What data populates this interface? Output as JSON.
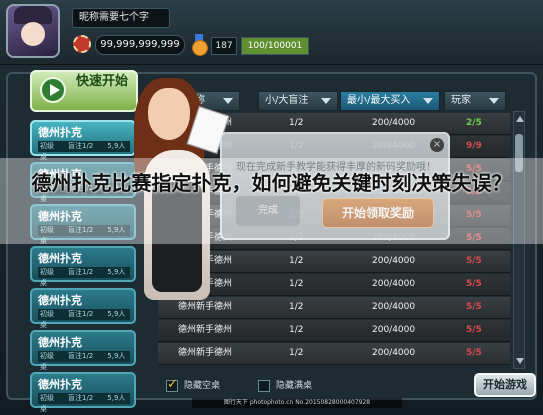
{
  "player": {
    "nickname": "昵称需要七个字",
    "coins": "99,999,999,999",
    "level": "187",
    "xp_text": "100/100001",
    "xp_fraction": 1.0
  },
  "quick_start": {
    "label": "快速开始"
  },
  "room_list": [
    {
      "name": "德州扑克",
      "sub": "初级　　盲注1/2　　5,9人桌"
    },
    {
      "name": "德州扑克",
      "sub": "初级　　盲注1/2　　5,9人桌"
    },
    {
      "name": "德州扑克",
      "sub": "初级　　盲注1/2　　5,9人桌"
    },
    {
      "name": "德州扑克",
      "sub": "初级　　盲注1/2　　5,9人桌"
    },
    {
      "name": "德州扑克",
      "sub": "初级　　盲注1/2　　5,9人桌"
    },
    {
      "name": "德州扑克",
      "sub": "初级　　盲注1/2　　5,9人桌"
    },
    {
      "name": "德州扑克",
      "sub": "初级　　盲注1/2　　5,9人桌"
    }
  ],
  "table": {
    "columns": [
      "名称",
      "小/大盲注",
      "最小/最大买入",
      "玩家"
    ],
    "rows": [
      {
        "name": "德州新手德州",
        "blinds": "1/2",
        "buyin": "200/4000",
        "players": "2/5",
        "status": "green"
      },
      {
        "name": "德州新手德州",
        "blinds": "1/2",
        "buyin": "200/4000",
        "players": "9/9",
        "status": "red"
      },
      {
        "name": "德州新手德州",
        "blinds": "1/2",
        "buyin": "200/4000",
        "players": "5/5",
        "status": "red"
      },
      {
        "name": "德州新手德州",
        "blinds": "1/2",
        "buyin": "200/4000",
        "players": "5/5",
        "status": "red"
      },
      {
        "name": "德州新手德州",
        "blinds": "1/2",
        "buyin": "200/4000",
        "players": "5/5",
        "status": "red"
      },
      {
        "name": "德州新手德州",
        "blinds": "1/2",
        "buyin": "200/4000",
        "players": "5/5",
        "status": "red"
      },
      {
        "name": "德州新手德州",
        "blinds": "1/2",
        "buyin": "200/4000",
        "players": "5/5",
        "status": "red"
      },
      {
        "name": "德州新手德州",
        "blinds": "1/2",
        "buyin": "200/4000",
        "players": "5/5",
        "status": "red"
      },
      {
        "name": "德州新手德州",
        "blinds": "1/2",
        "buyin": "200/4000",
        "players": "5/5",
        "status": "red"
      },
      {
        "name": "德州新手德州",
        "blinds": "1/2",
        "buyin": "200/4000",
        "players": "5/5",
        "status": "red"
      },
      {
        "name": "德州新手德州",
        "blinds": "1/2",
        "buyin": "200/4000",
        "players": "5/5",
        "status": "red"
      }
    ]
  },
  "promo": {
    "text": "现在完成新手教学能获得丰厚的新码奖励哦！",
    "side_label": "完成",
    "button_label": "开始领取奖励"
  },
  "overlay": {
    "headline": "德州扑克比赛指定扑克，如何避免关键时刻决策失误？"
  },
  "bottom": {
    "hide_empty_label": "隐藏空桌",
    "hide_full_label": "隐藏满桌",
    "start_label": "开始游戏"
  },
  "watermark": {
    "text": "图行天下 photophoto.cn No.20150828000407928"
  },
  "colors": {
    "accent_green": "#6fcf4a",
    "full_red": "#d64b4b",
    "room_teal": "#2c7b8b"
  }
}
